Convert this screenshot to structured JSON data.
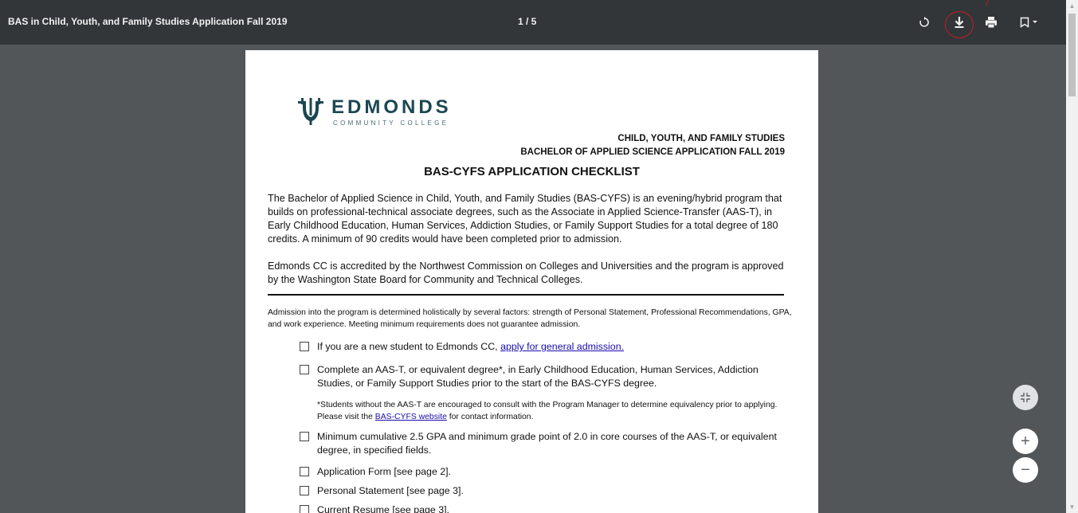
{
  "toolbar": {
    "title": "BAS in Child, Youth, and Family Studies Application Fall 2019",
    "page_indicator": "1 / 5",
    "icons": [
      "rotate-icon",
      "download-icon",
      "print-icon",
      "bookmark-icon"
    ]
  },
  "document": {
    "logo_name": "EDMONDS",
    "logo_sub": "COMMUNITY COLLEGE",
    "header_line1": "CHILD, YOUTH, AND FAMILY STUDIES",
    "header_line2": "BACHELOR OF APPLIED SCIENCE APPLICATION FALL 2019",
    "checklist_title": "BAS-CYFS APPLICATION CHECKLIST",
    "para1": "The Bachelor of Applied Science in Child, Youth, and Family Studies (BAS-CYFS) is an evening/hybrid program that builds on professional-technical associate degrees, such as the Associate in Applied Science-Transfer (AAS-T), in Early Childhood Education, Human Services, Addiction Studies, or Family Support Studies for a total degree of 180 credits. A minimum of 90 credits would have been completed prior to admission.",
    "para2": "Edmonds CC is accredited by the Northwest Commission on Colleges and Universities and the program is approved by the Washington State Board for Community and Technical Colleges.",
    "admission_para": "Admission into the program is determined holistically by several factors: strength of Personal Statement, Professional Recommendations, GPA, and work experience. Meeting minimum requirements does not guarantee admission.",
    "item1_text": "If you are a new student to Edmonds CC,",
    "item1_link": "apply for general admission.",
    "item2_text": "Complete an AAS-T, or equivalent degree*, in Early Childhood Education, Human Services, Addiction Studies, or Family Support Studies prior to the start of the BAS-CYFS degree.",
    "note_text1": "*Students without the AAS-T are encouraged to consult with the Program Manager to determine equivalency prior to applying. Please visit the",
    "note_link": "BAS-CYFS website",
    "note_text2": "for contact information.",
    "item3_text": "Minimum cumulative 2.5 GPA and minimum grade point of 2.0 in core courses of the AAS-T, or equivalent degree, in specified fields.",
    "item4_text": "Application Form [see page 2].",
    "item5_text": "Personal Statement [see page 3].",
    "item6_text": "Current Resume [see page 3]."
  },
  "controls": {
    "zoom_in": "+",
    "zoom_out": "−"
  }
}
